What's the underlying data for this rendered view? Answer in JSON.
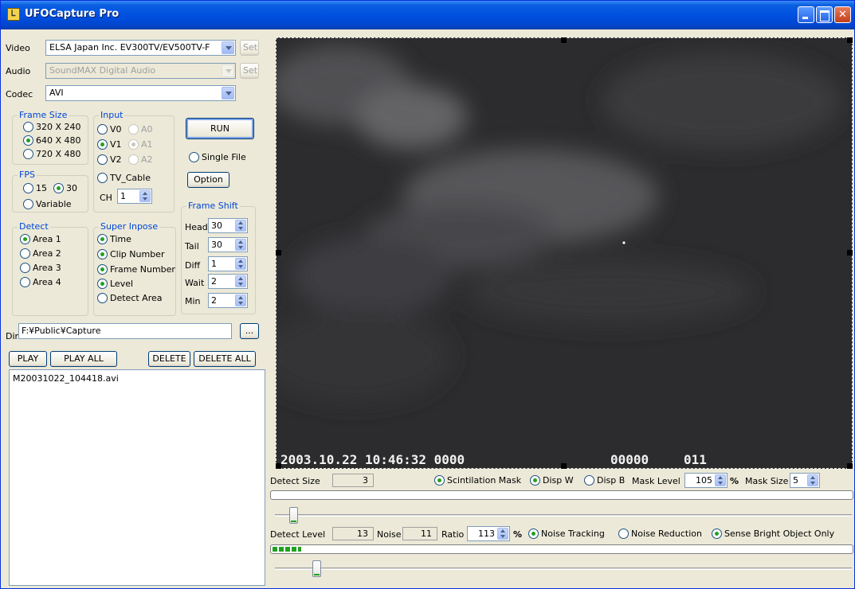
{
  "app": {
    "title": "UFOCapture Pro",
    "icon_label": "Ꮮ"
  },
  "source": {
    "video_label": "Video",
    "video_value": "ELSA Japan Inc. EV300TV/EV500TV-F",
    "audio_label": "Audio",
    "audio_value": "SoundMAX Digital Audio",
    "codec_label": "Codec",
    "codec_value": "AVI",
    "set_label": "Set"
  },
  "frame_size": {
    "title": "Frame Size",
    "options": [
      "320 X 240",
      "640 X 480",
      "720 X 480"
    ],
    "selected": "640 X 480"
  },
  "input": {
    "title": "Input",
    "v": [
      "V0",
      "V1",
      "V2"
    ],
    "a": [
      "A0",
      "A1",
      "A2"
    ],
    "tv_cable": "TV_Cable",
    "ch_label": "CH",
    "ch_value": "1"
  },
  "fps": {
    "title": "FPS",
    "opt15": "15",
    "opt30": "30",
    "variable": "Variable"
  },
  "controls": {
    "run": "RUN",
    "single_file": "Single File",
    "option": "Option"
  },
  "frame_shift": {
    "title": "Frame Shift",
    "rows": [
      {
        "label": "Head",
        "value": "30"
      },
      {
        "label": "Tail",
        "value": "30"
      },
      {
        "label": "Diff",
        "value": "1"
      },
      {
        "label": "Wait",
        "value": "2"
      },
      {
        "label": "Min",
        "value": "2"
      }
    ]
  },
  "detect": {
    "title": "Detect",
    "areas": [
      "Area 1",
      "Area 2",
      "Area 3",
      "Area 4"
    ]
  },
  "super_impose": {
    "title": "Super Inpose",
    "items": [
      "Time",
      "Clip Number",
      "Frame Number",
      "Level",
      "Detect Area"
    ]
  },
  "dir": {
    "label": "Dir:",
    "value": "F:¥Public¥Capture",
    "browse": "..."
  },
  "files": {
    "play": "PLAY",
    "play_all": "PLAY ALL",
    "delete": "DELETE",
    "delete_all": "DELETE ALL",
    "items": [
      "M20031022_104418.avi"
    ]
  },
  "overlay": {
    "datetime": "2003.10.22  10:46:32 0000",
    "frame_no": "00000",
    "level": "011"
  },
  "bottom": {
    "detect_size_label": "Detect Size",
    "detect_size_value": "3",
    "scintillation_mask": "Scintilation Mask",
    "disp_w": "Disp W",
    "disp_b": "Disp B",
    "mask_level_label": "Mask Level",
    "mask_level_value": "105",
    "percent": "%",
    "mask_size_label": "Mask Size",
    "mask_size_value": "5",
    "detect_level_label": "Detect Level",
    "detect_level_value": "13",
    "noise_label": "Noise",
    "noise_value": "11",
    "ratio_label": "Ratio",
    "ratio_value": "113",
    "noise_tracking": "Noise Tracking",
    "noise_reduction": "Noise Reduction",
    "sense_bright": "Sense Bright Object Only",
    "level_bar_fraction": 0.05,
    "slider1_fraction": 0.02,
    "slider2_fraction": 0.06
  },
  "colors": {
    "title_blue": "#0050e0",
    "group_title": "#0046d5",
    "progress_green": "#21a121"
  }
}
